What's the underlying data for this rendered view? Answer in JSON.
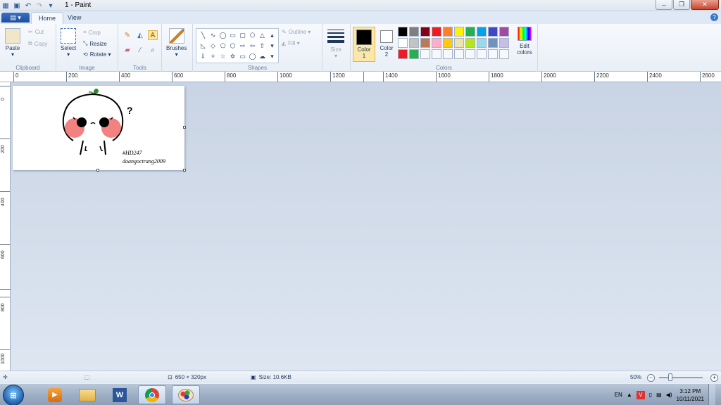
{
  "window": {
    "title": "1 - Paint",
    "minimize_glyph": "–",
    "maximize_glyph": "❐",
    "close_glyph": "✕"
  },
  "qat": {
    "save_icon": "save-icon",
    "undo_icon": "undo-icon",
    "redo_icon": "redo-icon",
    "customize_icon": "chevron-down-icon"
  },
  "tabs": {
    "file": "▤ ▾",
    "home": "Home",
    "view": "View"
  },
  "ribbon": {
    "clipboard": {
      "label": "Clipboard",
      "paste": "Paste",
      "cut": "Cut",
      "copy": "Copy"
    },
    "image": {
      "label": "Image",
      "select": "Select",
      "crop": "Crop",
      "resize": "Resize",
      "rotate": "Rotate ▾"
    },
    "tools": {
      "label": "Tools"
    },
    "brushes": {
      "label": "Brushes"
    },
    "shapes": {
      "label": "Shapes",
      "outline": "Outline ▾",
      "fill": "Fill ▾"
    },
    "size": {
      "label": "Size"
    },
    "colors": {
      "label": "Colors",
      "color1_label": "Color 1",
      "color1_value": "#000000",
      "color2_label": "Color 2",
      "color2_value": "#ffffff",
      "edit_colors": "Edit colors",
      "palette": [
        "#000000",
        "#7f7f7f",
        "#880015",
        "#ed1c24",
        "#ff7f27",
        "#fff200",
        "#22b14c",
        "#00a2e8",
        "#3f48cc",
        "#a349a4",
        "#ffffff",
        "#c3c3c3",
        "#b97a57",
        "#ffaec9",
        "#ffc90e",
        "#efe4b0",
        "#b5e61d",
        "#99d9ea",
        "#7092be",
        "#c8bfe7",
        "#ed1c24",
        "#22b14c",
        "#f5f8fc",
        "#f5f8fc",
        "#f5f8fc",
        "#f5f8fc",
        "#f5f8fc",
        "#f5f8fc",
        "#f5f8fc",
        "#f5f8fc"
      ]
    }
  },
  "ruler": {
    "h_labels": [
      "0",
      "200",
      "400",
      "600",
      "800",
      "1000",
      "1200",
      "1400",
      "1600",
      "1800",
      "2000",
      "2200",
      "2400",
      "2600"
    ],
    "v_labels": [
      "0",
      "200",
      "400",
      "600",
      "800",
      "1000"
    ]
  },
  "canvas": {
    "question_mark": "?",
    "watermark_line1": "#HD247",
    "watermark_line2": "doangoctrang2009"
  },
  "status": {
    "dimensions": "650 × 320px",
    "size": "Size: 10.6KB",
    "zoom": "50%",
    "zoom_out": "−",
    "zoom_in": "+"
  },
  "taskbar": {
    "start": "⊞",
    "word_letter": "W",
    "lang": "EN",
    "time": "3:12 PM",
    "date": "10/11/2021",
    "tray_up": "▲"
  }
}
